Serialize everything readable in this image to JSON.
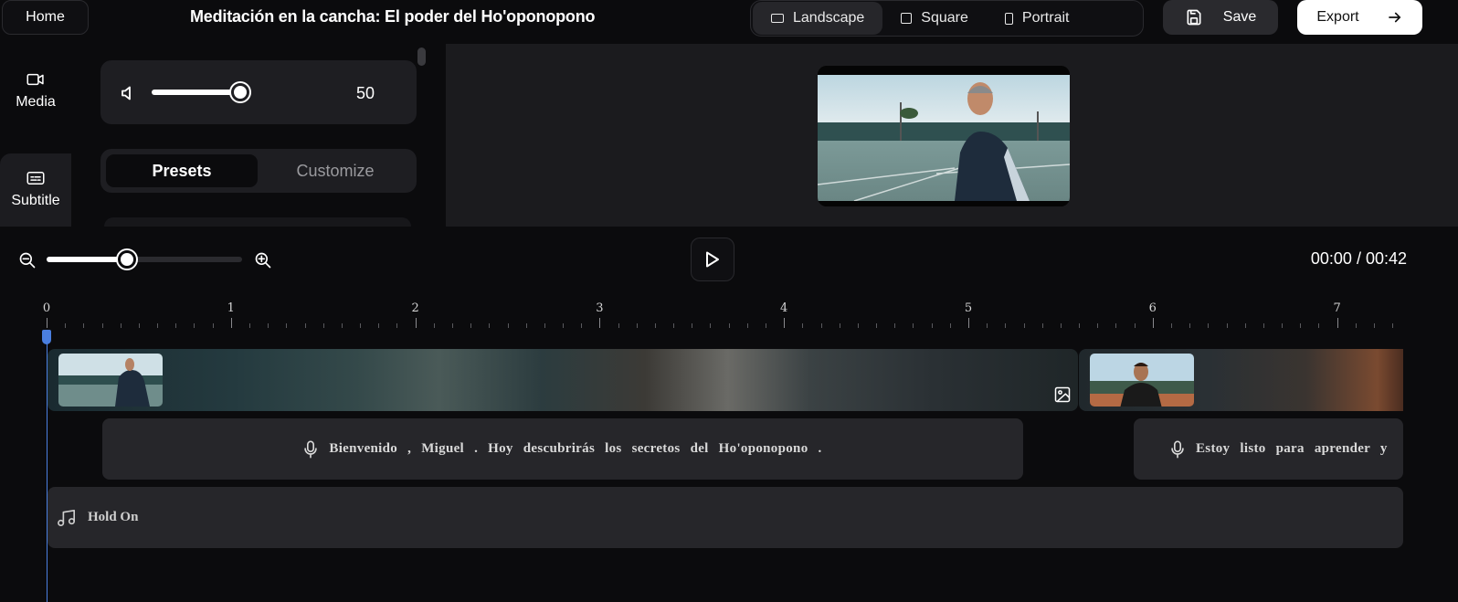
{
  "topbar": {
    "home_label": "Home",
    "project_title": "Meditación en la cancha: El poder del Ho'oponopono",
    "aspect_ratios": [
      {
        "label": "Landscape",
        "icon": "landscape-icon",
        "active": true
      },
      {
        "label": "Square",
        "icon": "square-icon",
        "active": false
      },
      {
        "label": "Portrait",
        "icon": "portrait-icon",
        "active": false
      }
    ],
    "save_label": "Save",
    "export_label": "Export"
  },
  "sidebar": {
    "items": [
      {
        "label": "Media",
        "icon": "video-camera-icon",
        "active": false
      },
      {
        "label": "Subtitle",
        "icon": "subtitle-icon",
        "active": true
      }
    ]
  },
  "panel": {
    "volume_value": "50",
    "volume_level": 0.5,
    "tabs": {
      "presets": "Presets",
      "customize": "Customize",
      "active": "presets"
    }
  },
  "timeline": {
    "current_time": "00:00",
    "total_time": "00:42",
    "separator": " / ",
    "zoom_level": 0.41,
    "ruler_labels": [
      "0",
      "1",
      "2",
      "3",
      "4",
      "5",
      "6",
      "7"
    ],
    "subtitles": [
      {
        "text": "Bienvenido , Miguel . Hoy descubrirás los secretos del Ho'oponopono ."
      },
      {
        "text": "Estoy listo para aprender y"
      }
    ],
    "audio_track_label": "Hold On"
  },
  "colors": {
    "background": "#0b0b0d",
    "panel": "#1e1e22",
    "track": "#26262a",
    "playhead": "#4a7fe0",
    "export_button": "#ffffff"
  }
}
